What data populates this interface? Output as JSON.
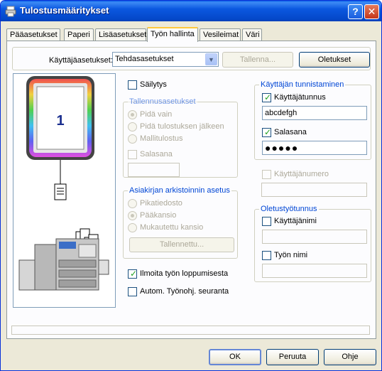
{
  "window": {
    "title": "Tulostusmääritykset",
    "help_icon": "help-icon",
    "close_icon": "close-icon"
  },
  "tabs": [
    {
      "label": "Pääasetukset",
      "active": false
    },
    {
      "label": "Paperi",
      "active": false
    },
    {
      "label": "Lisäasetukset",
      "active": false
    },
    {
      "label": "Työn hallinta",
      "active": true
    },
    {
      "label": "Vesileimat",
      "active": false
    },
    {
      "label": "Väri",
      "active": false
    }
  ],
  "toolbar": {
    "user_settings_label": "Käyttäjäasetukset:",
    "user_settings_value": "Tehdasasetukset",
    "save_label": "Tallenna...",
    "defaults_label": "Oletukset"
  },
  "preview": {
    "page_number": "1"
  },
  "retention": {
    "label": "Säilytys",
    "checked": false
  },
  "save_settings": {
    "title": "Tallennusasetukset",
    "options": [
      "Pidä vain",
      "Pidä tulostuksen jälkeen",
      "Mallitulostus"
    ],
    "password_label": "Salasana"
  },
  "archive": {
    "title": "Asiakirjan arkistoinnin asetus",
    "options": [
      "Pikatiedosto",
      "Pääkansio",
      "Mukautettu kansio"
    ],
    "saved_button": "Tallennettu..."
  },
  "notify_job_end": {
    "label": "Ilmoita työn loppumisesta",
    "checked": true
  },
  "auto_job_control": {
    "label": "Autom. Työnohj. seuranta",
    "checked": false
  },
  "user_auth": {
    "title": "Käyttäjän tunnistaminen",
    "username_label": "Käyttäjätunnus",
    "username_checked": true,
    "username_value": "abcdefgh",
    "password_label": "Salasana",
    "password_checked": true,
    "password_value": "●●●●●",
    "user_number_label": "Käyttäjänumero"
  },
  "default_job_id": {
    "title": "Oletustyötunnus",
    "user_name_label": "Käyttäjänimi",
    "job_name_label": "Työn nimi"
  },
  "footer": {
    "ok_label": "OK",
    "cancel_label": "Peruuta",
    "help_label": "Ohje"
  }
}
